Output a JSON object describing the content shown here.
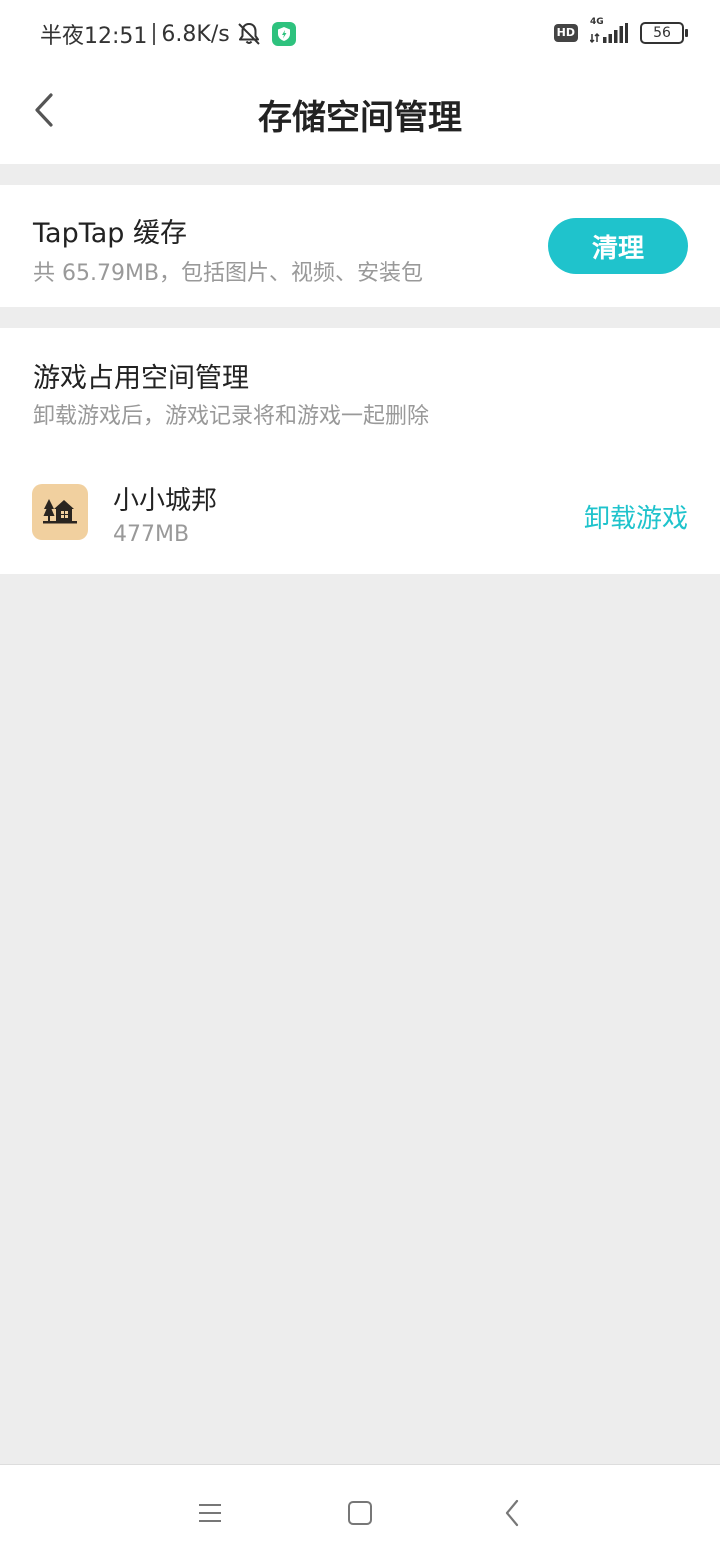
{
  "status_bar": {
    "time": "半夜12:51",
    "speed": "6.8K/s",
    "hd": "HD",
    "network_type": "4G",
    "battery": "56",
    "icons": [
      "bell-off-icon",
      "shield-icon",
      "signal-icon"
    ]
  },
  "header": {
    "title": "存储空间管理",
    "back_icon": "back-chevron-icon"
  },
  "cache": {
    "title": "TapTap 缓存",
    "description": "共 65.79MB，包括图片、视频、安装包",
    "button_label": "清理"
  },
  "game_space": {
    "title": "游戏占用空间管理",
    "description": "卸载游戏后，游戏记录将和游戏一起删除",
    "games": [
      {
        "name": "小小城邦",
        "size": "477MB",
        "action_label": "卸载游戏",
        "icon": "house-trees-icon"
      }
    ]
  },
  "nav_bar": {
    "icons": [
      "menu-icon",
      "home-icon",
      "back-icon"
    ]
  },
  "colors": {
    "accent": "#1fc3cc",
    "background": "#ededed",
    "card": "#ffffff",
    "muted_text": "#999999",
    "game_icon_bg": "#f1d09f"
  }
}
